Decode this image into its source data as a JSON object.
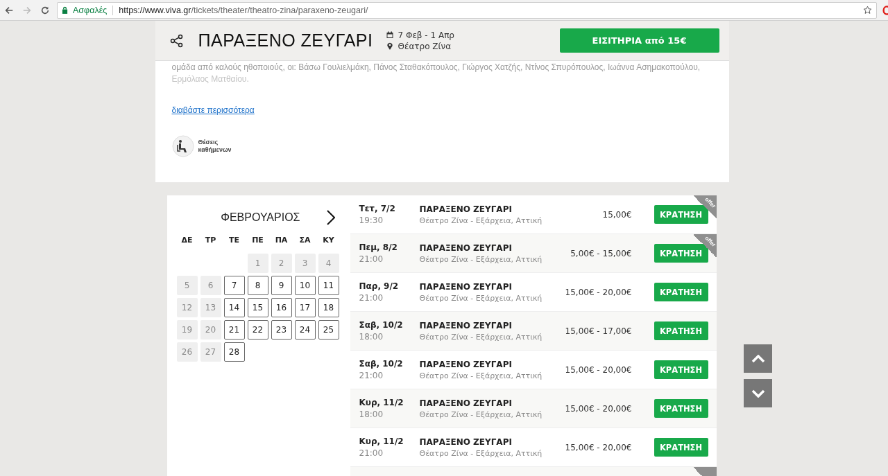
{
  "browser": {
    "secure_label": "Ασφαλές",
    "url_host": "https://www.viva.gr",
    "url_path": "/tickets/theater/theatro-zina/paraxeno-zeugari/"
  },
  "header": {
    "title": "ΠΑΡΑΞΕΝΟ ΖΕΥΓΑΡΙ",
    "dates": "7 Φεβ - 1 Απρ",
    "venue": "Θέατρο Ζίνα",
    "ticket_button": "ΕΙΣΙΤΗΡΙΑ από 15€"
  },
  "description": [
    "ομάδα από καλούς ηθοποιούς, οι: Βάσω Γουλιελμάκη, Πάνος Σταθακόπουλος, Γιώργος Χατζής, Ντίνος Σπυρόπουλος, Ιωάννα Ασημακοπούλου,",
    "Ερμόλαος Ματθαίου."
  ],
  "read_more": "διαβάστε περισσότερα",
  "feature": {
    "label": "Θέσεις καθήμενων"
  },
  "calendar": {
    "month": "ΦΕΒΡΟΥΑΡΙΟΣ",
    "weekdays": [
      "ΔΕ",
      "ΤΡ",
      "ΤΕ",
      "ΠΕ",
      "ΠΑ",
      "ΣΑ",
      "ΚΥ"
    ],
    "days": [
      {
        "kind": "blank"
      },
      {
        "kind": "blank"
      },
      {
        "kind": "blank"
      },
      {
        "kind": "day",
        "label": "1",
        "available": false
      },
      {
        "kind": "day",
        "label": "2",
        "available": false
      },
      {
        "kind": "day",
        "label": "3",
        "available": false
      },
      {
        "kind": "day",
        "label": "4",
        "available": false
      },
      {
        "kind": "day",
        "label": "5",
        "available": false
      },
      {
        "kind": "day",
        "label": "6",
        "available": false
      },
      {
        "kind": "day",
        "label": "7",
        "available": true
      },
      {
        "kind": "day",
        "label": "8",
        "available": true
      },
      {
        "kind": "day",
        "label": "9",
        "available": true
      },
      {
        "kind": "day",
        "label": "10",
        "available": true
      },
      {
        "kind": "day",
        "label": "11",
        "available": true
      },
      {
        "kind": "day",
        "label": "12",
        "available": false
      },
      {
        "kind": "day",
        "label": "13",
        "available": false
      },
      {
        "kind": "day",
        "label": "14",
        "available": true
      },
      {
        "kind": "day",
        "label": "15",
        "available": true
      },
      {
        "kind": "day",
        "label": "16",
        "available": true
      },
      {
        "kind": "day",
        "label": "17",
        "available": true
      },
      {
        "kind": "day",
        "label": "18",
        "available": true
      },
      {
        "kind": "day",
        "label": "19",
        "available": false
      },
      {
        "kind": "day",
        "label": "20",
        "available": false
      },
      {
        "kind": "day",
        "label": "21",
        "available": true
      },
      {
        "kind": "day",
        "label": "22",
        "available": true
      },
      {
        "kind": "day",
        "label": "23",
        "available": true
      },
      {
        "kind": "day",
        "label": "24",
        "available": true
      },
      {
        "kind": "day",
        "label": "25",
        "available": true
      },
      {
        "kind": "day",
        "label": "26",
        "available": false
      },
      {
        "kind": "day",
        "label": "27",
        "available": false
      },
      {
        "kind": "day",
        "label": "28",
        "available": true
      }
    ]
  },
  "performances": [
    {
      "kind": "full",
      "date": "Τετ, 7/2",
      "time": "19:30",
      "title": "ΠΑΡΑΞΕΝΟ ΖΕΥΓΑΡΙ",
      "venue": "Θέατρο Ζίνα - Εξάρχεια, Αττική",
      "price": "15,00€",
      "button": "ΚΡΑΤΗΣΗ",
      "offer": "offer"
    },
    {
      "kind": "full",
      "date": "Πεμ, 8/2",
      "time": "21:00",
      "title": "ΠΑΡΑΞΕΝΟ ΖΕΥΓΑΡΙ",
      "venue": "Θέατρο Ζίνα - Εξάρχεια, Αττική",
      "price": "5,00€ - 15,00€",
      "button": "ΚΡΑΤΗΣΗ",
      "offer": "offer"
    },
    {
      "kind": "full",
      "date": "Παρ, 9/2",
      "time": "21:00",
      "title": "ΠΑΡΑΞΕΝΟ ΖΕΥΓΑΡΙ",
      "venue": "Θέατρο Ζίνα - Εξάρχεια, Αττική",
      "price": "15,00€ - 20,00€",
      "button": "ΚΡΑΤΗΣΗ"
    },
    {
      "kind": "full",
      "date": "Σαβ, 10/2",
      "time": "18:00",
      "title": "ΠΑΡΑΞΕΝΟ ΖΕΥΓΑΡΙ",
      "venue": "Θέατρο Ζίνα - Εξάρχεια, Αττική",
      "price": "15,00€ - 17,00€",
      "button": "ΚΡΑΤΗΣΗ"
    },
    {
      "kind": "full",
      "date": "Σαβ, 10/2",
      "time": "21:00",
      "title": "ΠΑΡΑΞΕΝΟ ΖΕΥΓΑΡΙ",
      "venue": "Θέατρο Ζίνα - Εξάρχεια, Αττική",
      "price": "15,00€ - 20,00€",
      "button": "ΚΡΑΤΗΣΗ"
    },
    {
      "kind": "full",
      "date": "Κυρ, 11/2",
      "time": "18:00",
      "title": "ΠΑΡΑΞΕΝΟ ΖΕΥΓΑΡΙ",
      "venue": "Θέατρο Ζίνα - Εξάρχεια, Αττική",
      "price": "15,00€ - 20,00€",
      "button": "ΚΡΑΤΗΣΗ"
    },
    {
      "kind": "full",
      "date": "Κυρ, 11/2",
      "time": "21:00",
      "title": "ΠΑΡΑΞΕΝΟ ΖΕΥΓΑΡΙ",
      "venue": "Θέατρο Ζίνα - Εξάρχεια, Αττική",
      "price": "15,00€ - 20,00€",
      "button": "ΚΡΑΤΗΣΗ"
    },
    {
      "kind": "stub",
      "ribbon": true
    }
  ]
}
